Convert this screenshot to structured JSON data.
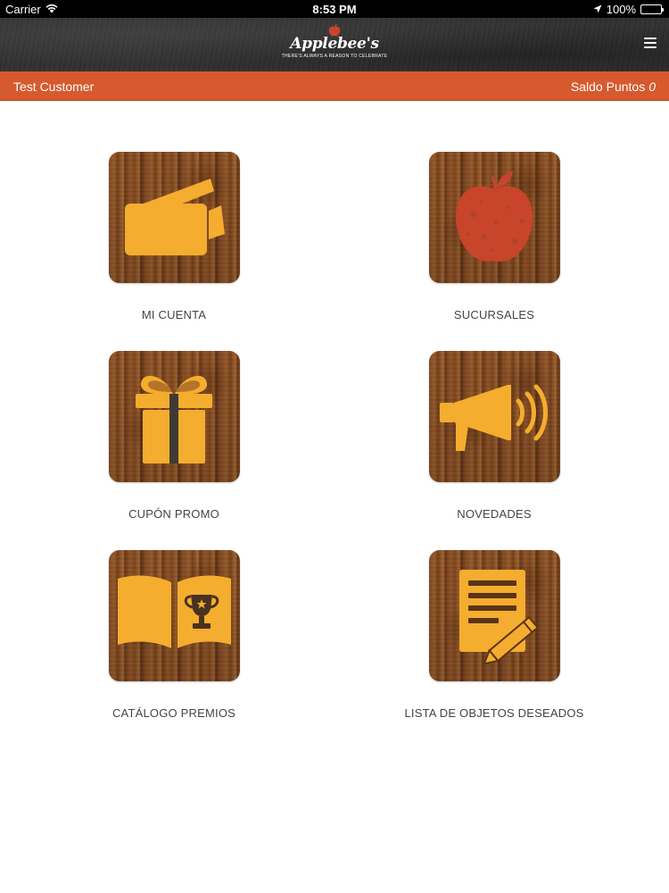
{
  "status_bar": {
    "carrier": "Carrier",
    "time": "8:53 PM",
    "battery": "100%",
    "battery_level": 1.0
  },
  "header": {
    "logo_text": "Applebee's",
    "logo_tagline": "THERE'S ALWAYS A REASON TO CELEBRATE",
    "menu_icon": "hamburger-icon"
  },
  "user_bar": {
    "customer_name": "Test Customer",
    "points_label": "Saldo Puntos",
    "points_value": "0"
  },
  "tiles": [
    {
      "label": "MI CUENTA",
      "icon": "credit-cards-icon"
    },
    {
      "label": "SUCURSALES",
      "icon": "apple-icon"
    },
    {
      "label": "CUPÓN PROMO",
      "icon": "gift-icon"
    },
    {
      "label": "NOVEDADES",
      "icon": "megaphone-icon"
    },
    {
      "label": "CATÁLOGO PREMIOS",
      "icon": "open-book-trophy-icon"
    },
    {
      "label": "LISTA DE OBJETOS DESEADOS",
      "icon": "note-pencil-icon"
    }
  ],
  "colors": {
    "accent_orange": "#d65a2e",
    "icon_yellow": "#f4ad2e",
    "apple_red": "#c8442a",
    "header_dark": "#333333"
  }
}
